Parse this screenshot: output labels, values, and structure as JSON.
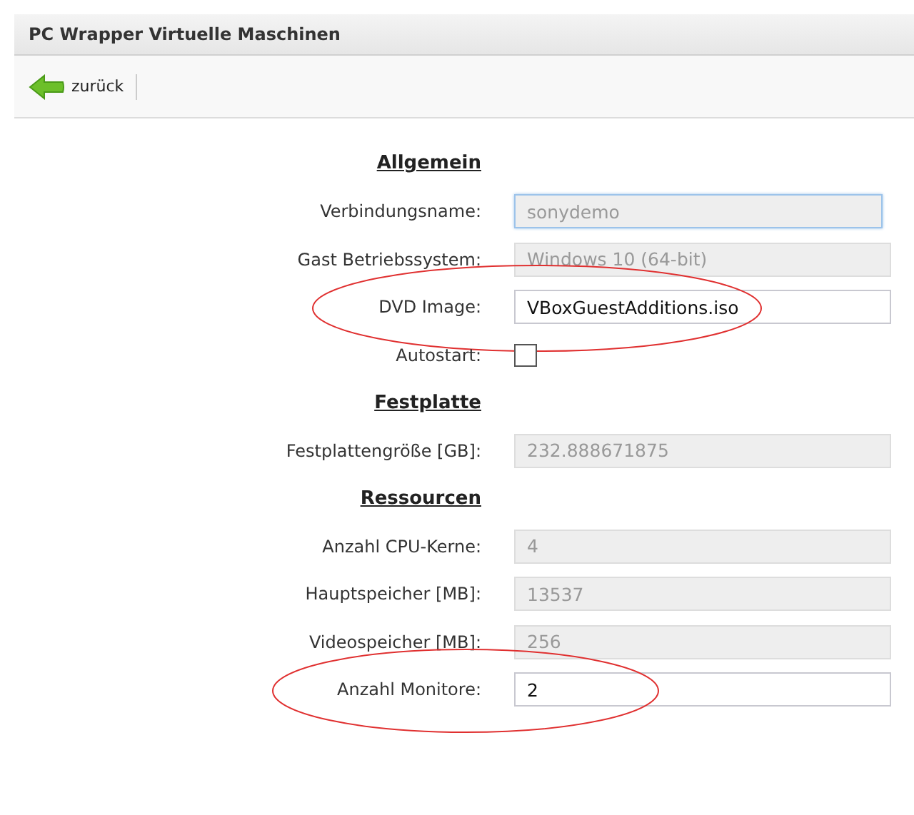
{
  "window": {
    "title": "PC Wrapper Virtuelle Maschinen"
  },
  "toolbar": {
    "back_button": "zurück"
  },
  "form": [
    {
      "kind": "heading",
      "label": "Allgemein"
    },
    {
      "kind": "field",
      "label": "Verbindungsname:",
      "value": "sonydemo",
      "disabled": true,
      "focused": true,
      "annotated": false
    },
    {
      "kind": "field",
      "label": "Gast Betriebssystem:",
      "value": "Windows 10 (64-bit)",
      "disabled": true,
      "focused": false,
      "annotated": false
    },
    {
      "kind": "field",
      "label": "DVD Image:",
      "value": "VBoxGuestAdditions.iso",
      "disabled": false,
      "focused": false,
      "annotated": true
    },
    {
      "kind": "checkbox",
      "label": "Autostart:",
      "checked": false
    },
    {
      "kind": "heading",
      "label": "Festplatte"
    },
    {
      "kind": "field",
      "label": "Festplattengröße [GB]:",
      "value": "232.888671875",
      "disabled": true,
      "focused": false,
      "annotated": false
    },
    {
      "kind": "heading",
      "label": "Ressourcen"
    },
    {
      "kind": "field",
      "label": "Anzahl CPU-Kerne:",
      "value": "4",
      "disabled": true,
      "focused": false,
      "annotated": false
    },
    {
      "kind": "field",
      "label": "Hauptspeicher [MB]:",
      "value": "13537",
      "disabled": true,
      "focused": false,
      "annotated": false
    },
    {
      "kind": "field",
      "label": "Videospeicher [MB]:",
      "value": "256",
      "disabled": true,
      "focused": false,
      "annotated": false
    },
    {
      "kind": "field",
      "label": "Anzahl Monitore:",
      "value": "2",
      "disabled": false,
      "focused": false,
      "annotated": true
    }
  ]
}
